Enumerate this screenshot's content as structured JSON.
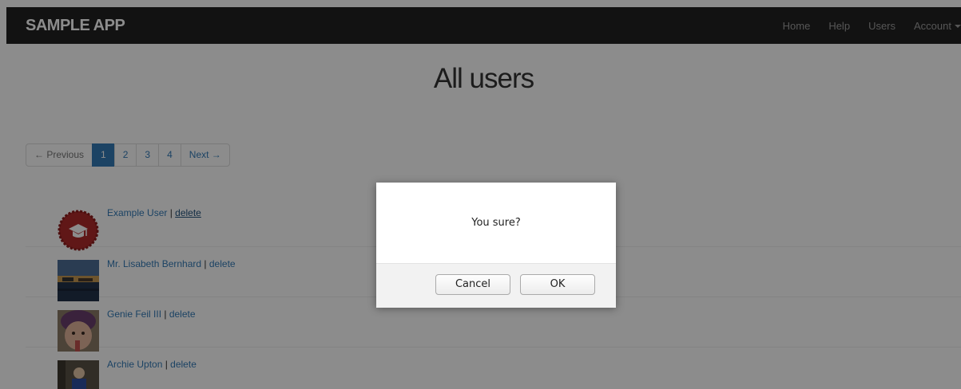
{
  "navbar": {
    "brand": "SAMPLE APP",
    "links": {
      "home": "Home",
      "help": "Help",
      "users": "Users",
      "account": "Account"
    }
  },
  "page": {
    "title": "All users"
  },
  "pagination": {
    "previous": "← Previous",
    "pages": [
      "1",
      "2",
      "3",
      "4"
    ],
    "active_page": "1",
    "next": "Next →"
  },
  "users": [
    {
      "name": "Example User",
      "separator": " | ",
      "action": "delete",
      "avatar": "graduation-cap-badge-icon"
    },
    {
      "name": "Mr. Lisabeth Bernhard",
      "separator": " | ",
      "action": "delete",
      "avatar": "harbor-photo"
    },
    {
      "name": "Genie Feil III",
      "separator": " | ",
      "action": "delete",
      "avatar": "child-portrait-photo"
    },
    {
      "name": "Archie Upton",
      "separator": " | ",
      "action": "delete",
      "avatar": "person-portrait-photo"
    }
  ],
  "dialog": {
    "message": "You sure?",
    "cancel_label": "Cancel",
    "ok_label": "OK"
  },
  "colors": {
    "navbar_bg": "#222222",
    "link": "#337ab7",
    "active_page_bg": "#337ab7",
    "overlay": "rgba(0,0,0,0.45)"
  }
}
